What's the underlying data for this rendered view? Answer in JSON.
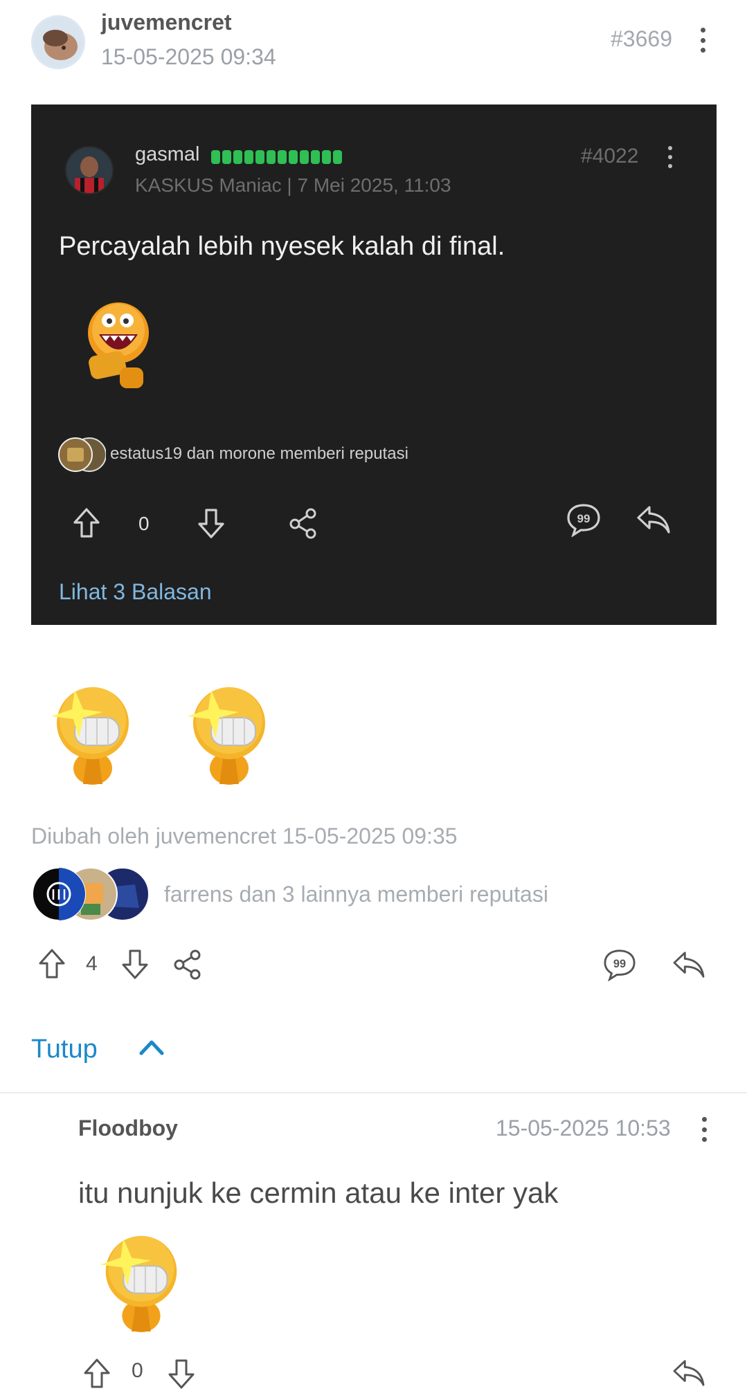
{
  "post": {
    "username": "juvemencret",
    "timestamp": "15-05-2025 09:34",
    "post_number": "#3669",
    "avatar_icon": "user-avatar",
    "quoted_screenshot": {
      "username": "gasmal",
      "meta": "KASKUS Maniac | 7 Mei 2025, 11:03",
      "post_number": "#4022",
      "text": "Percayalah lebih nyesek kalah di final.",
      "reputation_text": "estatus19 dan morone memberi reputasi",
      "vote_count": "0",
      "view_replies": "Lihat 3 Balasan",
      "rank_color": "#2fbf55",
      "link_color": "#7fb8e0"
    },
    "edited_note": "Diubah oleh juvemencret 15-05-2025 09:35",
    "reputation_text": "farrens dan 3 lainnya memberi reputasi",
    "vote_count": "4",
    "collapse_label": "Tutup"
  },
  "reply": {
    "username": "Floodboy",
    "timestamp": "15-05-2025 10:53",
    "text": "itu nunjuk ke cermin atau ke inter yak",
    "vote_count": "0"
  },
  "colors": {
    "accent": "#1b88c9",
    "muted_text": "#a7acb1",
    "quote_bg": "#1f1f1f"
  }
}
